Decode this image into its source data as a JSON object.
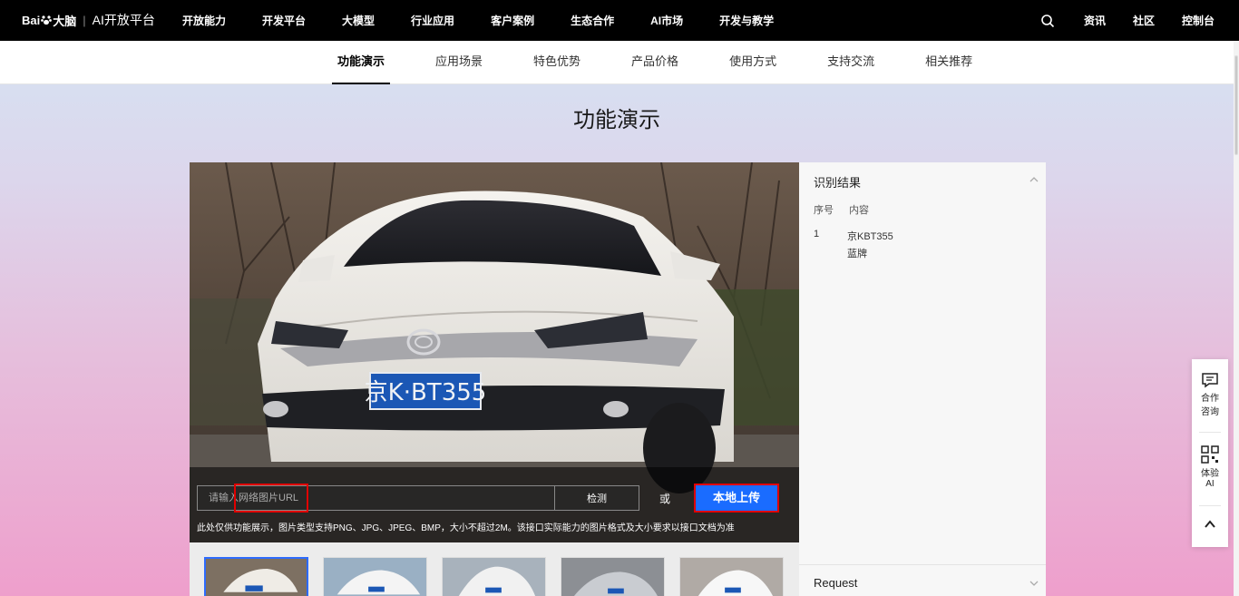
{
  "brand": {
    "logo_part1": "Bai",
    "logo_part2": "大脑",
    "separator": "|",
    "platform": "AI开放平台"
  },
  "topnav": {
    "items": [
      "开放能力",
      "开发平台",
      "大模型",
      "行业应用",
      "客户案例",
      "生态合作",
      "AI市场",
      "开发与教学"
    ],
    "right": [
      "资讯",
      "社区",
      "控制台"
    ]
  },
  "subnav": {
    "tabs": [
      "功能演示",
      "应用场景",
      "特色优势",
      "产品价格",
      "使用方式",
      "支持交流",
      "相关推荐"
    ],
    "active": "功能演示"
  },
  "section_title": "功能演示",
  "demo": {
    "plate_text": "京K·BT355",
    "url_placeholder": "请输入网络图片URL",
    "detect_label": "检测",
    "or_label": "或",
    "upload_label": "本地上传",
    "note": "此处仅供功能展示，图片类型支持PNG、JPG、JPEG、BMP，大小不超过2M。该接口实际能力的图片格式及大小要求以接口文档为准"
  },
  "result": {
    "title": "识别结果",
    "columns": [
      "序号",
      "内容"
    ],
    "rows": [
      {
        "index": "1",
        "line1": "京KBT355",
        "line2": "蓝牌"
      }
    ],
    "request_label": "Request"
  },
  "float_widget": {
    "consult_label_1": "合作",
    "consult_label_2": "咨询",
    "try_label_1": "体验",
    "try_label_2": "AI"
  },
  "colors": {
    "accent": "#1a6cff",
    "highlight_box": "#e00000",
    "topnav_bg": "#000000"
  }
}
